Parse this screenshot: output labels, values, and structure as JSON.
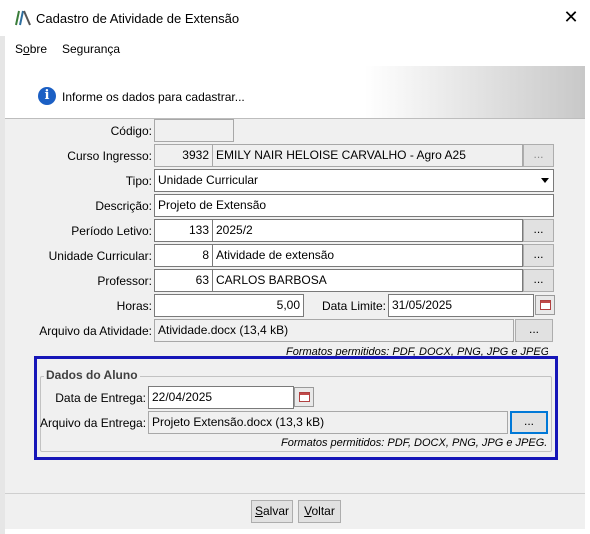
{
  "window": {
    "title": "Cadastro de Atividade de Extensão",
    "close_glyph": "✕",
    "logo_icon": "app-logo-icon"
  },
  "menu": {
    "items": [
      {
        "label_pre": "S",
        "label_ul": "o",
        "label_post": "bre"
      },
      {
        "label_pre": "Segurança",
        "label_ul": "",
        "label_post": ""
      }
    ]
  },
  "banner": {
    "icon": "info-icon",
    "icon_glyph": "i",
    "text": "Informe os dados para cadastrar..."
  },
  "form": {
    "codigo": {
      "label": "Código:",
      "value": ""
    },
    "curso": {
      "label": "Curso Ingresso:",
      "code": "3932",
      "name": "EMILY NAIR HELOISE CARVALHO - Agro A25",
      "lookup": "..."
    },
    "tipo": {
      "label": "Tipo:",
      "value": "Unidade Curricular"
    },
    "descricao": {
      "label": "Descrição:",
      "value": "Projeto de Extensão"
    },
    "periodo": {
      "label": "Período Letivo:",
      "code": "133",
      "name": "2025/2",
      "lookup": "..."
    },
    "unidade": {
      "label": "Unidade Curricular:",
      "code": "8",
      "name": "Atividade de extensão",
      "lookup": "..."
    },
    "professor": {
      "label": "Professor:",
      "code": "63",
      "name": "CARLOS BARBOSA",
      "lookup": "..."
    },
    "horas": {
      "label": "Horas:",
      "value": "5,00"
    },
    "data_limite": {
      "label": "Data Limite:",
      "value": "31/05/2025"
    },
    "arquivo": {
      "label": "Arquivo da Atividade:",
      "value": "Atividade.docx (13,4 kB)",
      "lookup": "...",
      "hint": "Formatos permitidos: PDF, DOCX, PNG, JPG e JPEG."
    }
  },
  "aluno": {
    "legend": "Dados do Aluno",
    "data_entrega": {
      "label": "Data de Entrega:",
      "value": "22/04/2025"
    },
    "arquivo_entrega": {
      "label": "Arquivo da Entrega:",
      "value": "Projeto Extensão.docx (13,3 kB)",
      "lookup": "...",
      "hint": "Formatos permitidos: PDF, DOCX, PNG, JPG e JPEG."
    }
  },
  "footer": {
    "salvar": {
      "pre": "",
      "ul": "S",
      "post": "alvar"
    },
    "voltar": {
      "pre": "",
      "ul": "V",
      "post": "oltar"
    }
  },
  "colors": {
    "highlight_border": "#1616b8",
    "info_icon": "#1b5fc4"
  }
}
